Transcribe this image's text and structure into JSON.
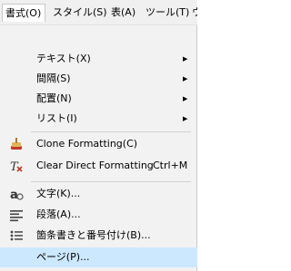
{
  "menubar": {
    "items": [
      {
        "label": "書式(O)"
      },
      {
        "label": "スタイル(S)"
      },
      {
        "label": "表(A)"
      },
      {
        "label": "ツール(T)"
      },
      {
        "label": "ウ"
      }
    ]
  },
  "menu": {
    "items": [
      {
        "label": "テキスト(X)",
        "submenu": true
      },
      {
        "label": "間隔(S)",
        "submenu": true
      },
      {
        "label": "配置(N)",
        "submenu": true
      },
      {
        "label": "リスト(I)",
        "submenu": true
      },
      {
        "label": "Clone Formatting(C)",
        "icon": "paintbrush-icon"
      },
      {
        "label": "Clear Direct Formatting",
        "shortcut": "Ctrl+M",
        "icon": "clear-formatting-icon"
      },
      {
        "label": "文字(K)...",
        "icon": "character-icon"
      },
      {
        "label": "段落(A)...",
        "icon": "paragraph-icon"
      },
      {
        "label": "箇条書きと番号付け(B)...",
        "icon": "bullets-numbering-icon"
      },
      {
        "label": "ページ(P)...",
        "highlighted": true
      }
    ]
  },
  "colors": {
    "highlight": "#cce8ff",
    "menu_bg": "#f2f2f2"
  }
}
